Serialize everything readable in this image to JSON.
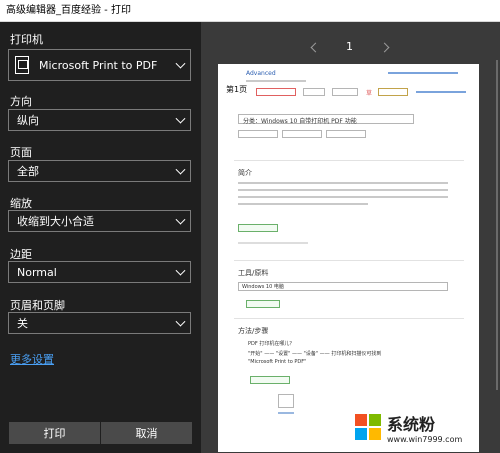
{
  "window": {
    "title": "高级编辑器_百度经验 - 打印"
  },
  "settings": {
    "printer": {
      "label": "打印机",
      "value": "Microsoft Print to PDF"
    },
    "orientation": {
      "label": "方向",
      "value": "纵向"
    },
    "pages": {
      "label": "页面",
      "value": "全部"
    },
    "scale": {
      "label": "缩放",
      "value": "收缩到大小合适"
    },
    "margins": {
      "label": "边距",
      "value": "Normal"
    },
    "headers": {
      "label": "页眉和页脚",
      "value": "关"
    },
    "more_settings": "更多设置"
  },
  "buttons": {
    "print": "打印",
    "cancel": "取消"
  },
  "preview": {
    "page_number": "1",
    "doc_title": "分类：Windows 10 自带打印机 PDF 功能",
    "intro_heading": "简介",
    "tools_heading": "工具/原料",
    "tools_item": "Windows 10 电脑",
    "steps_heading": "方法/步骤",
    "step1_title": "PDF 打印机在哪儿？",
    "step1_text_a": "\"开始\" —— \"设置\" —— \"设备\" —— 打印机和扫描仪可找到",
    "step1_text_b": "\"Microsoft Print to PDF\"",
    "page_mark": "第1页",
    "draft": "草",
    "top_link": "Advanced"
  },
  "watermark": {
    "name": "系统粉",
    "url": "www.win7999.com",
    "colors": [
      "#f25022",
      "#7fba00",
      "#00a4ef",
      "#ffb900"
    ]
  }
}
